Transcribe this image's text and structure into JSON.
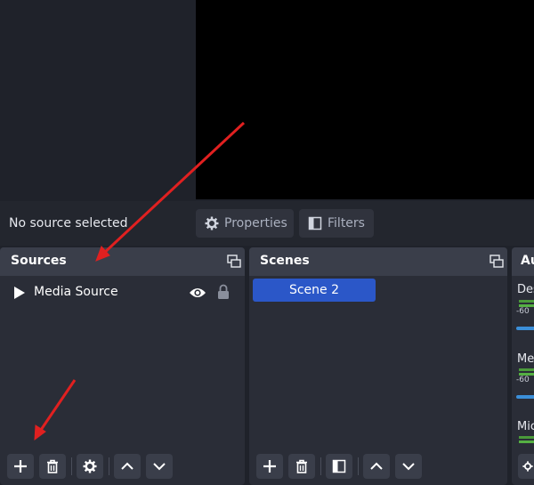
{
  "context_bar": {
    "status": "No source selected",
    "properties_label": "Properties",
    "filters_label": "Filters"
  },
  "sources": {
    "title": "Sources",
    "items": [
      {
        "label": "Media Source"
      }
    ]
  },
  "scenes": {
    "title": "Scenes",
    "items": [
      {
        "label": "Scene 2",
        "selected": true
      }
    ]
  },
  "audio": {
    "title": "Au",
    "channels": [
      {
        "name": "Des",
        "level_label": "-60"
      },
      {
        "name": "Me",
        "level_label": "-60"
      },
      {
        "name": "Mic"
      }
    ]
  },
  "colors": {
    "accent": "#2b57c8",
    "panel": "#2a2d37",
    "title_bar": "#3a3e4a",
    "annotation_arrow": "#e02020"
  }
}
